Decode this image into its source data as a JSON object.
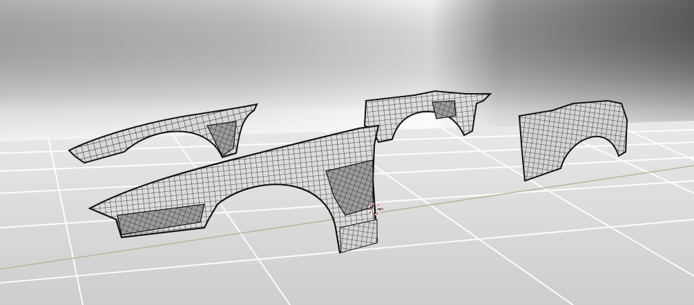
{
  "viewport": {
    "view_mode": "wireframe-over-solid",
    "objects": [
      {
        "name": "fender-front-left-small"
      },
      {
        "name": "fender-front-large"
      },
      {
        "name": "fender-rear-panel"
      },
      {
        "name": "fender-rear-right"
      }
    ],
    "colors": {
      "background_light": "#e8e8e8",
      "background_dark": "#6a6a6a",
      "floor": "#d9d9d9",
      "grid_line": "#ffffff",
      "axis_line": "#b9b79a",
      "wire": "#141414",
      "surface": "#d6d6d6",
      "cursor_red": "#e05a5a"
    },
    "grid_visible": true,
    "cursor_icon": "3d-cursor-icon"
  }
}
